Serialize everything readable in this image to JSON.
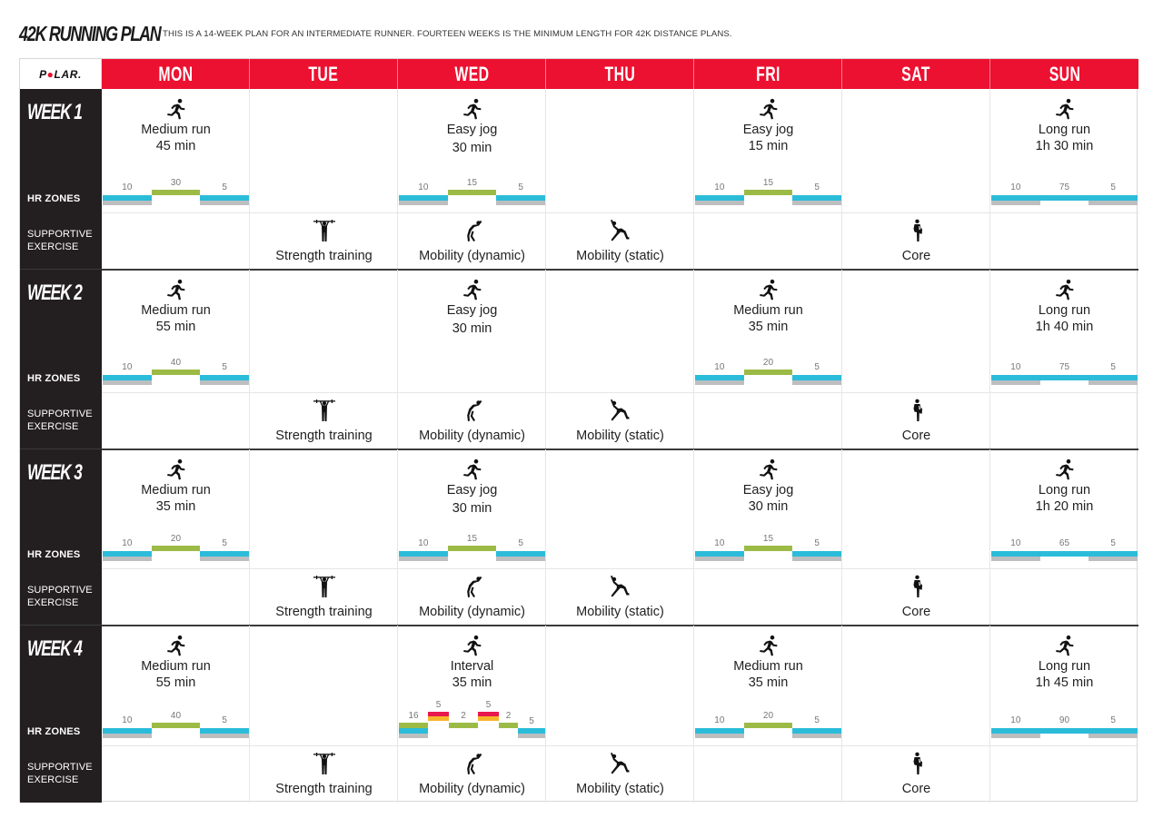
{
  "title": "42K RUNNING PLAN",
  "subtitle": "THIS IS A 14-WEEK PLAN FOR AN INTERMEDIATE RUNNER. FOURTEEN WEEKS IS THE MINIMUM LENGTH FOR 42K DISTANCE PLANS.",
  "logo": {
    "text_a": "P",
    "dot": "●",
    "text_b": "LAR."
  },
  "days": [
    "MON",
    "TUE",
    "WED",
    "THU",
    "FRI",
    "SAT",
    "SUN"
  ],
  "row_labels": {
    "hr_zones": "HR ZONES",
    "supportive_line1": "SUPPORTIVE",
    "supportive_line2": "EXERCISE"
  },
  "colors": {
    "brand_red": "#ec1131",
    "label_bg": "#231f20",
    "zone1_gray": "#bcbec0",
    "zone2_blue": "#2bbcd9",
    "zone3_green": "#9cbb46",
    "zone4_yellow": "#f7b52c",
    "zone5_red": "#e8174e"
  },
  "supportive": {
    "TUE": {
      "icon": "strength-training-icon",
      "label": "Strength training"
    },
    "WED": {
      "icon": "mobility-dynamic-icon",
      "label": "Mobility (dynamic)"
    },
    "THU": {
      "icon": "mobility-static-icon",
      "label": "Mobility (static)"
    },
    "SAT": {
      "icon": "core-icon",
      "label": "Core"
    }
  },
  "weeks": [
    {
      "label": "WEEK 1",
      "runs": {
        "MON": {
          "name": "Medium run",
          "duration": "45 min",
          "zones": {
            "type": "steady",
            "segments": [
              {
                "minutes": "10",
                "zone": 2
              },
              {
                "minutes": "30",
                "zone": 3
              },
              {
                "minutes": "5",
                "zone": 2
              }
            ]
          }
        },
        "WED": {
          "name": "Easy jog",
          "duration": "30 min",
          "zones": {
            "type": "steady",
            "segments": [
              {
                "minutes": "10",
                "zone": 2
              },
              {
                "minutes": "15",
                "zone": 3
              },
              {
                "minutes": "5",
                "zone": 2
              }
            ]
          }
        },
        "FRI": {
          "name": "Easy jog",
          "duration": "15 min",
          "zones": {
            "type": "steady",
            "segments": [
              {
                "minutes": "10",
                "zone": 2
              },
              {
                "minutes": "15",
                "zone": 3
              },
              {
                "minutes": "5",
                "zone": 2
              }
            ]
          }
        },
        "SUN": {
          "name": "Long run",
          "duration": "1h 30 min",
          "zones": {
            "type": "steady",
            "segments": [
              {
                "minutes": "10",
                "zone": 2
              },
              {
                "minutes": "75",
                "zone": 2
              },
              {
                "minutes": "5",
                "zone": 2
              }
            ]
          }
        }
      }
    },
    {
      "label": "WEEK 2",
      "runs": {
        "MON": {
          "name": "Medium run",
          "duration": "55 min",
          "zones": {
            "type": "steady",
            "segments": [
              {
                "minutes": "10",
                "zone": 2
              },
              {
                "minutes": "40",
                "zone": 3
              },
              {
                "minutes": "5",
                "zone": 2
              }
            ]
          }
        },
        "WED": {
          "name": "Easy jog",
          "duration": "30 min",
          "zones": null
        },
        "FRI": {
          "name": "Medium run",
          "duration": "35 min",
          "zones": {
            "type": "steady",
            "segments": [
              {
                "minutes": "10",
                "zone": 2
              },
              {
                "minutes": "20",
                "zone": 3
              },
              {
                "minutes": "5",
                "zone": 2
              }
            ]
          }
        },
        "SUN": {
          "name": "Long run",
          "duration": "1h 40 min",
          "zones": {
            "type": "steady",
            "segments": [
              {
                "minutes": "10",
                "zone": 2
              },
              {
                "minutes": "75",
                "zone": 2
              },
              {
                "minutes": "5",
                "zone": 2
              }
            ]
          }
        }
      }
    },
    {
      "label": "WEEK 3",
      "runs": {
        "MON": {
          "name": "Medium run",
          "duration": "35 min",
          "zones": {
            "type": "steady",
            "segments": [
              {
                "minutes": "10",
                "zone": 2
              },
              {
                "minutes": "20",
                "zone": 3
              },
              {
                "minutes": "5",
                "zone": 2
              }
            ]
          }
        },
        "WED": {
          "name": "Easy jog",
          "duration": "30 min",
          "zones": {
            "type": "steady",
            "segments": [
              {
                "minutes": "10",
                "zone": 2
              },
              {
                "minutes": "15",
                "zone": 3
              },
              {
                "minutes": "5",
                "zone": 2
              }
            ]
          }
        },
        "FRI": {
          "name": "Easy jog",
          "duration": "30 min",
          "zones": {
            "type": "steady",
            "segments": [
              {
                "minutes": "10",
                "zone": 2
              },
              {
                "minutes": "15",
                "zone": 3
              },
              {
                "minutes": "5",
                "zone": 2
              }
            ]
          }
        },
        "SUN": {
          "name": "Long run",
          "duration": "1h 20 min",
          "zones": {
            "type": "steady",
            "segments": [
              {
                "minutes": "10",
                "zone": 2
              },
              {
                "minutes": "65",
                "zone": 2
              },
              {
                "minutes": "5",
                "zone": 2
              }
            ]
          }
        }
      }
    },
    {
      "label": "WEEK 4",
      "runs": {
        "MON": {
          "name": "Medium run",
          "duration": "55 min",
          "zones": {
            "type": "steady",
            "segments": [
              {
                "minutes": "10",
                "zone": 2
              },
              {
                "minutes": "40",
                "zone": 3
              },
              {
                "minutes": "5",
                "zone": 2
              }
            ]
          }
        },
        "WED": {
          "name": "Interval",
          "duration": "35 min",
          "zones": {
            "type": "interval",
            "segments": [
              {
                "minutes": "16",
                "zone": 3
              },
              {
                "minutes": "5",
                "zone": 5
              },
              {
                "minutes": "2",
                "zone": 3
              },
              {
                "minutes": "5",
                "zone": 5
              },
              {
                "minutes": "2",
                "zone": 3
              },
              {
                "minutes": "5",
                "zone": 2
              }
            ]
          }
        },
        "FRI": {
          "name": "Medium run",
          "duration": "35 min",
          "zones": {
            "type": "steady",
            "segments": [
              {
                "minutes": "10",
                "zone": 2
              },
              {
                "minutes": "20",
                "zone": 3
              },
              {
                "minutes": "5",
                "zone": 2
              }
            ]
          }
        },
        "SUN": {
          "name": "Long run",
          "duration": "1h 45 min",
          "zones": {
            "type": "steady",
            "segments": [
              {
                "minutes": "10",
                "zone": 2
              },
              {
                "minutes": "90",
                "zone": 2
              },
              {
                "minutes": "5",
                "zone": 2
              }
            ]
          }
        }
      }
    }
  ]
}
